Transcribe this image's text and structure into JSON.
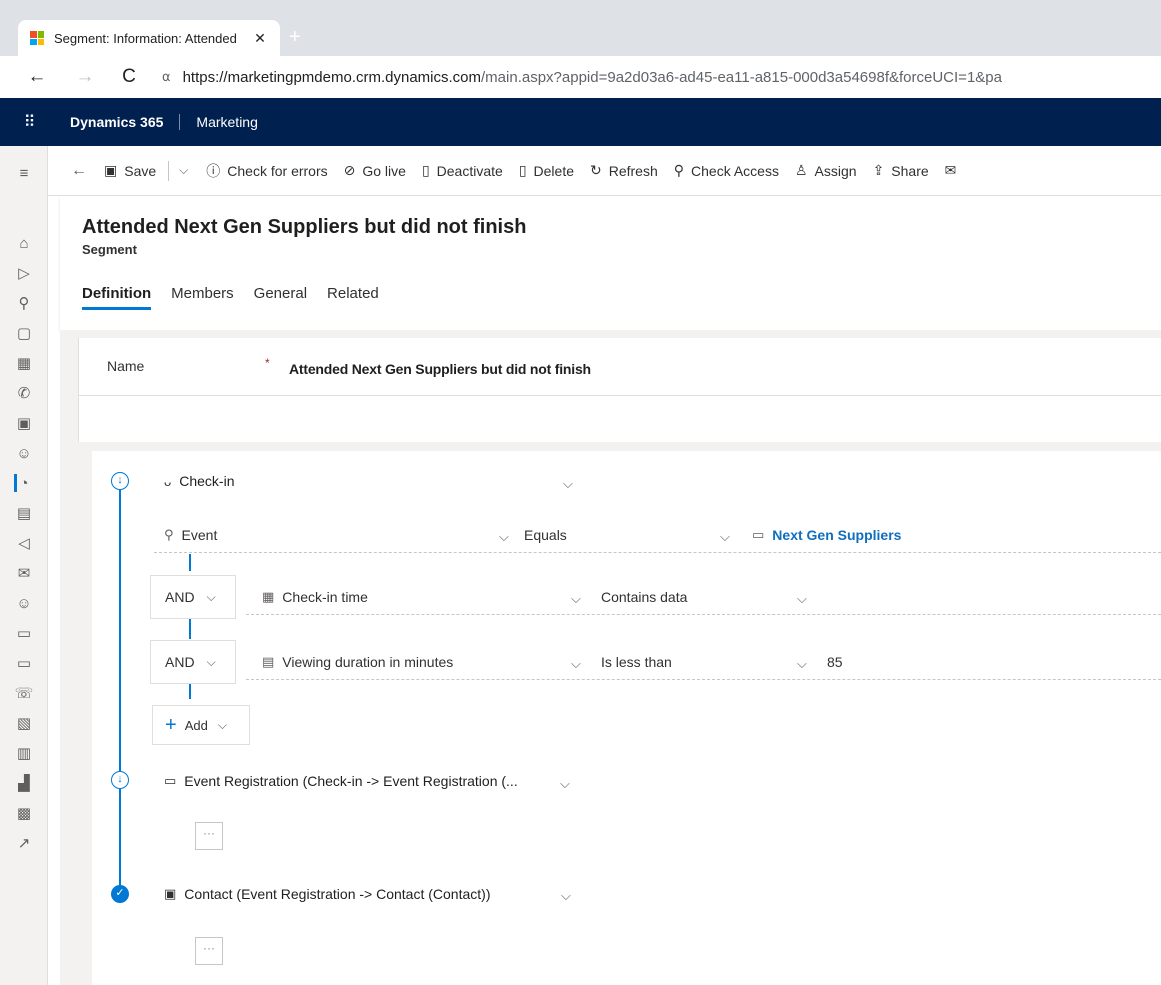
{
  "browser": {
    "tab_title": "Segment: Information: Attended",
    "tab_close": "✕",
    "new_tab": "+",
    "url_host": "https://marketingpmdemo.crm.dynamics.com",
    "url_path": "/main.aspx?appid=9a2d03a6-ad45-ea11-a815-000d3a54698f&forceUCI=1&pa"
  },
  "app": {
    "brand": "Dynamics 365",
    "module": "Marketing"
  },
  "commands": [
    {
      "label": "Save",
      "icon": "save-icon"
    },
    {
      "label": "Check for errors",
      "icon": "info-icon"
    },
    {
      "label": "Go live",
      "icon": "check-circle-icon"
    },
    {
      "label": "Deactivate",
      "icon": "deactivate-icon"
    },
    {
      "label": "Delete",
      "icon": "trash-icon"
    },
    {
      "label": "Refresh",
      "icon": "refresh-icon"
    },
    {
      "label": "Check Access",
      "icon": "key-icon"
    },
    {
      "label": "Assign",
      "icon": "person-icon"
    },
    {
      "label": "Share",
      "icon": "share-icon"
    }
  ],
  "record": {
    "title": "Attended Next Gen Suppliers but did not finish",
    "type": "Segment"
  },
  "tabs": [
    {
      "label": "Definition",
      "selected": true
    },
    {
      "label": "Members",
      "selected": false
    },
    {
      "label": "General",
      "selected": false
    },
    {
      "label": "Related",
      "selected": false
    }
  ],
  "form": {
    "name_label": "Name",
    "required_mark": "*",
    "name_value": "Attended Next Gen Suppliers but did not finish"
  },
  "designer": {
    "group1": {
      "entity": "Check-in",
      "condition1": {
        "field": "Event",
        "operator": "Equals",
        "value": "Next Gen Suppliers"
      },
      "condition2": {
        "logic": "AND",
        "field": "Check-in time",
        "operator": "Contains data"
      },
      "condition3": {
        "logic": "AND",
        "field": "Viewing duration in minutes",
        "operator": "Is less than",
        "value": "85"
      },
      "add_label": "Add"
    },
    "group2": {
      "entity": "Event Registration (Check-in -> Event Registration (..."
    },
    "group3": {
      "entity": "Contact (Event Registration -> Contact (Contact))"
    },
    "empty_placeholder": "···"
  },
  "colors": {
    "nav_bg": "#002050",
    "accent": "#0078d4",
    "link": "#106ebe"
  }
}
